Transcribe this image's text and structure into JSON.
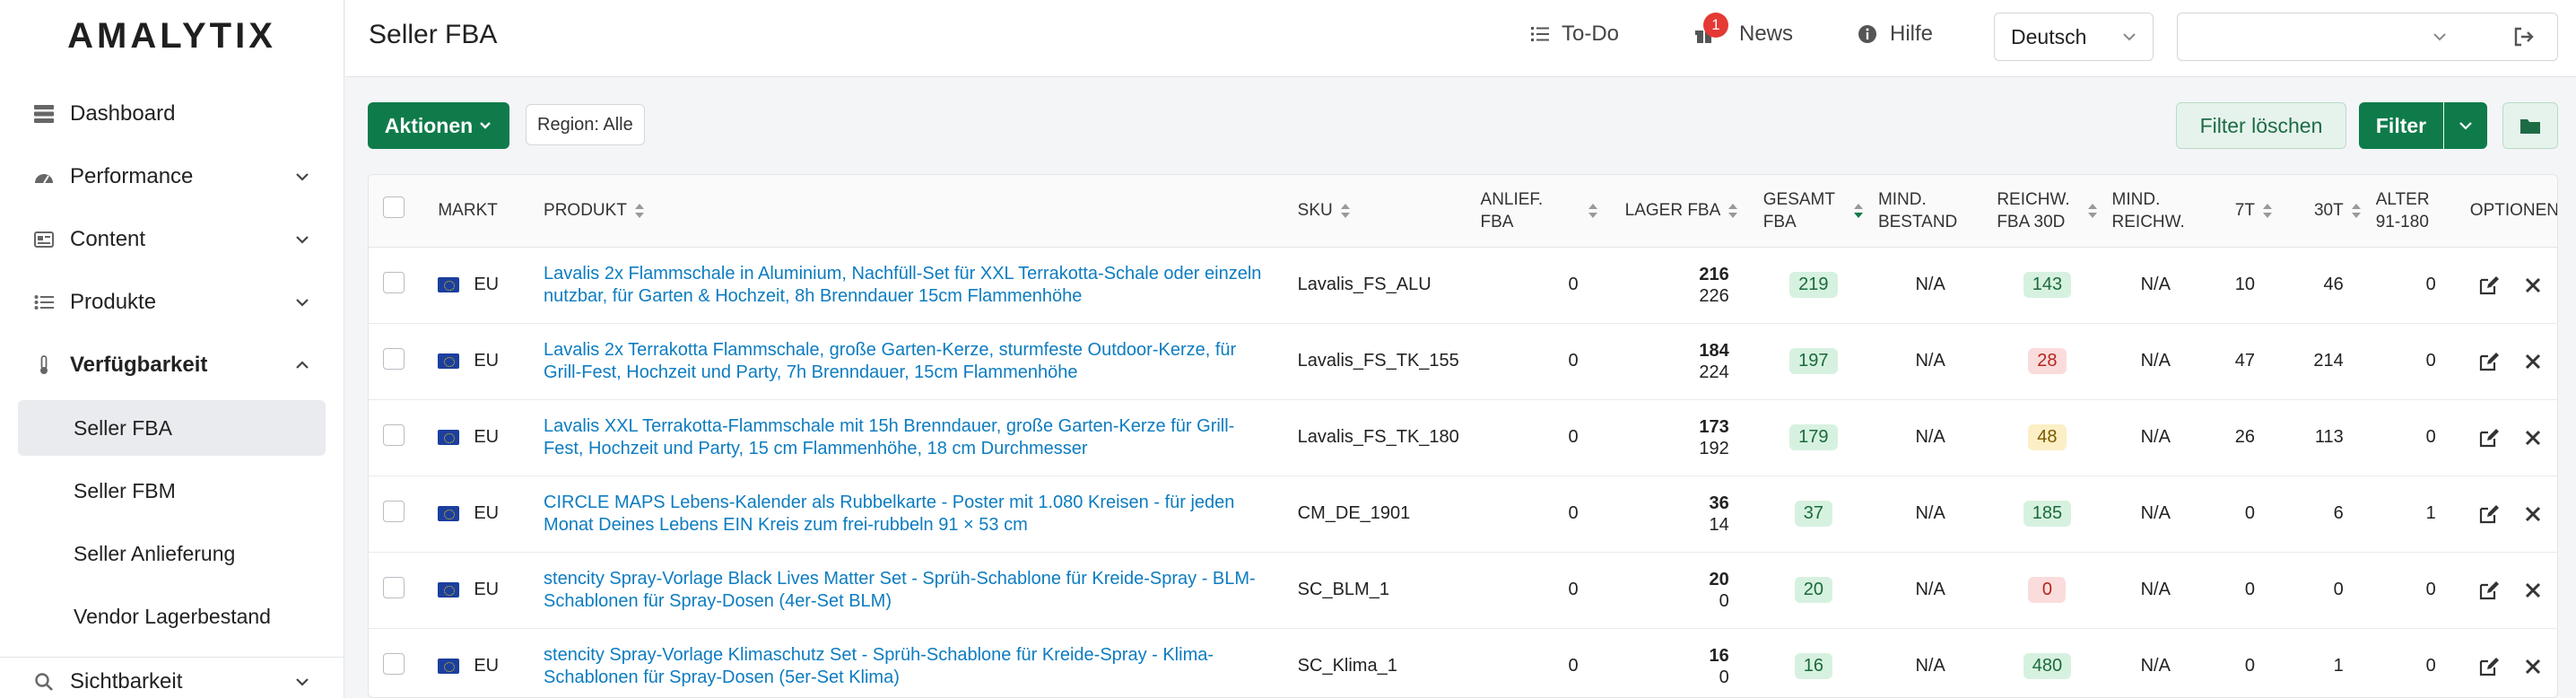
{
  "brand": {
    "logo": "AMALYTIX"
  },
  "sidebar": {
    "items": [
      {
        "label": "Dashboard"
      },
      {
        "label": "Performance"
      },
      {
        "label": "Content"
      },
      {
        "label": "Produkte"
      },
      {
        "label": "Verfügbarkeit"
      },
      {
        "label": "Sichtbarkeit"
      }
    ],
    "subitems": [
      {
        "label": "Seller FBA",
        "active": true
      },
      {
        "label": "Seller FBM"
      },
      {
        "label": "Seller Anlieferung"
      },
      {
        "label": "Vendor Lagerbestand"
      }
    ]
  },
  "header": {
    "title": "Seller FBA",
    "todo": "To-Do",
    "news": "News",
    "news_badge": "1",
    "help": "Hilfe",
    "language": "Deutsch",
    "account": ""
  },
  "toolbar": {
    "actions": "Aktionen",
    "region": "Region: Alle",
    "clear_filter": "Filter löschen",
    "filter": "Filter"
  },
  "table": {
    "columns": [
      {
        "l1": "MARKT",
        "l2": ""
      },
      {
        "l1": "PRODUKT",
        "l2": ""
      },
      {
        "l1": "SKU",
        "l2": ""
      },
      {
        "l1": "ANLIEF.",
        "l2": "FBA"
      },
      {
        "l1": "LAGER FBA",
        "l2": ""
      },
      {
        "l1": "GESAMT",
        "l2": "FBA"
      },
      {
        "l1": "MIND.",
        "l2": "BESTAND"
      },
      {
        "l1": "REICHW.",
        "l2": "FBA 30D"
      },
      {
        "l1": "MIND.",
        "l2": "REICHW."
      },
      {
        "l1": "7T",
        "l2": ""
      },
      {
        "l1": "30T",
        "l2": ""
      },
      {
        "l1": "ALTER",
        "l2": "91-180"
      },
      {
        "l1": "OPTIONEN",
        "l2": ""
      }
    ],
    "rows": [
      {
        "market": "EU",
        "product": "Lavalis 2x Flammschale in Aluminium, Nachfüll-Set für XXL Terrakotta-Schale oder einzeln nutzbar, für Garten & Hochzeit, 8h Brenndauer 15cm Flammenhöhe",
        "sku": "Lavalis_FS_ALU",
        "anlief": "0",
        "lager_top": "216",
        "lager_bottom": "226",
        "gesamt": "219",
        "mind_bestand": "N/A",
        "reichw": "143",
        "reichw_color": "green",
        "mind_reichw": "N/A",
        "t7": "10",
        "t30": "46",
        "alter": "0"
      },
      {
        "market": "EU",
        "product": "Lavalis 2x Terrakotta Flammschale, große Garten-Kerze, sturmfeste Outdoor-Kerze, für Grill-Fest, Hochzeit und Party, 7h Brenndauer, 15cm Flammenhöhe",
        "sku": "Lavalis_FS_TK_155",
        "anlief": "0",
        "lager_top": "184",
        "lager_bottom": "224",
        "gesamt": "197",
        "mind_bestand": "N/A",
        "reichw": "28",
        "reichw_color": "red",
        "mind_reichw": "N/A",
        "t7": "47",
        "t30": "214",
        "alter": "0"
      },
      {
        "market": "EU",
        "product": "Lavalis XXL Terrakotta-Flammschale mit 15h Brenndauer, große Garten-Kerze für Grill-Fest, Hochzeit und Party, 15 cm Flammenhöhe, 18 cm Durchmesser",
        "sku": "Lavalis_FS_TK_180",
        "anlief": "0",
        "lager_top": "173",
        "lager_bottom": "192",
        "gesamt": "179",
        "mind_bestand": "N/A",
        "reichw": "48",
        "reichw_color": "yellow",
        "mind_reichw": "N/A",
        "t7": "26",
        "t30": "113",
        "alter": "0"
      },
      {
        "market": "EU",
        "product": "CIRCLE MAPS Lebens-Kalender als Rubbelkarte - Poster mit 1.080 Kreisen - für jeden Monat Deines Lebens EIN Kreis zum frei-rubbeln 91 × 53 cm",
        "sku": "CM_DE_1901",
        "anlief": "0",
        "lager_top": "36",
        "lager_bottom": "14",
        "gesamt": "37",
        "mind_bestand": "N/A",
        "reichw": "185",
        "reichw_color": "green",
        "mind_reichw": "N/A",
        "t7": "0",
        "t30": "6",
        "alter": "1"
      },
      {
        "market": "EU",
        "product": "stencity Spray-Vorlage Black Lives Matter Set - Sprüh-Schablone für Kreide-Spray - BLM-Schablonen für Spray-Dosen (4er-Set BLM)",
        "sku": "SC_BLM_1",
        "anlief": "0",
        "lager_top": "20",
        "lager_bottom": "0",
        "gesamt": "20",
        "mind_bestand": "N/A",
        "reichw": "0",
        "reichw_color": "red",
        "mind_reichw": "N/A",
        "t7": "0",
        "t30": "0",
        "alter": "0"
      },
      {
        "market": "EU",
        "product": "stencity Spray-Vorlage Klimaschutz Set - Sprüh-Schablone für Kreide-Spray - Klima-Schablonen für Spray-Dosen (5er-Set Klima)",
        "sku": "SC_Klima_1",
        "anlief": "0",
        "lager_top": "16",
        "lager_bottom": "0",
        "gesamt": "16",
        "mind_bestand": "N/A",
        "reichw": "480",
        "reichw_color": "green",
        "mind_reichw": "N/A",
        "t7": "0",
        "t30": "1",
        "alter": "0"
      }
    ]
  },
  "colors": {
    "brand_green": "#0f7b4b",
    "link_blue": "#0d7cc0"
  }
}
